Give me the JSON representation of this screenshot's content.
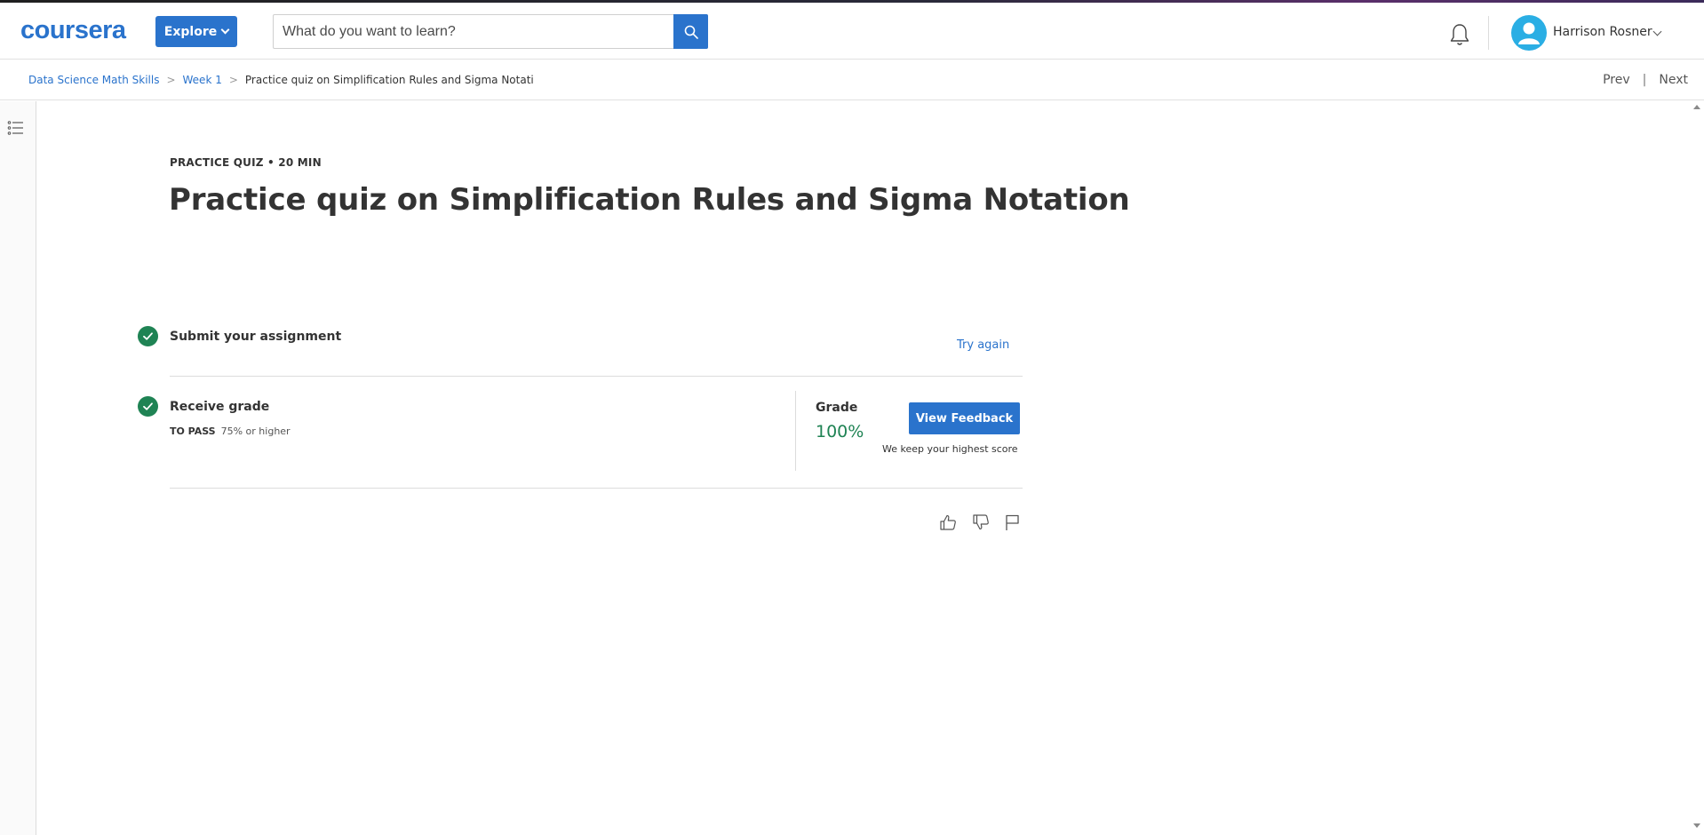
{
  "header": {
    "logo": "coursera",
    "explore_label": "Explore",
    "search": {
      "placeholder": "What do you want to learn?",
      "icon": "search-icon"
    },
    "notifications_icon": "bell-icon",
    "user": {
      "name": "Harrison Rosner",
      "avatar_icon": "user-avatar-icon"
    }
  },
  "breadcrumb": {
    "items": [
      "Data Science Math Skills",
      "Week 1"
    ],
    "current": "Practice quiz on Simplification Rules and Sigma Notati",
    "separator": ">"
  },
  "nav": {
    "prev": "Prev",
    "separator": "|",
    "next": "Next"
  },
  "sidebar": {
    "toggle_icon": "list-icon"
  },
  "quiz": {
    "meta": "PRACTICE QUIZ • 20 MIN",
    "title": "Practice quiz on Simplification Rules and Sigma Notation",
    "steps": [
      {
        "label": "Submit your assignment",
        "status": "complete",
        "action": "Try again"
      },
      {
        "label": "Receive grade",
        "status": "complete",
        "to_pass_label": "TO PASS",
        "to_pass_value": "75% or higher"
      }
    ],
    "grade": {
      "label": "Grade",
      "value": "100%",
      "button": "View Feedback",
      "note": "We keep your highest score"
    },
    "feedback_icons": [
      "thumbs-up-icon",
      "thumbs-down-icon",
      "flag-icon"
    ]
  },
  "colors": {
    "brand": "#2a73cc",
    "success": "#1f8354",
    "avatar": "#2aaee4"
  }
}
